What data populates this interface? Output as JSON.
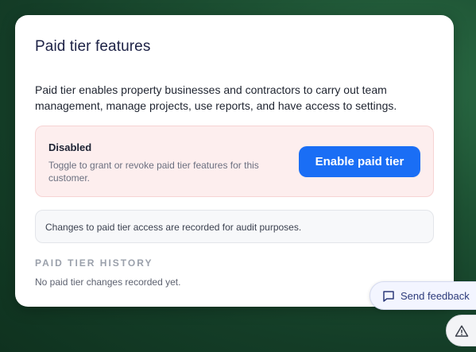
{
  "card": {
    "title": "Paid tier features",
    "description": "Paid tier enables property businesses and contractors to carry out team management, manage projects, use reports, and have access to settings."
  },
  "status": {
    "title": "Disabled",
    "hint": "Toggle to grant or revoke paid tier features for this customer.",
    "action_label": "Enable paid tier"
  },
  "audit": {
    "note": "Changes to paid tier access are recorded for audit purposes."
  },
  "history": {
    "heading": "PAID TIER HISTORY",
    "empty_text": "No paid tier changes recorded yet."
  },
  "feedback": {
    "label": "Send feedback",
    "icon": "message-square-icon"
  },
  "alert": {
    "icon": "warning-triangle-icon"
  },
  "colors": {
    "primary": "#1a6ef5",
    "disabled_bg": "#fdeeee",
    "title_text": "#1c2145"
  }
}
